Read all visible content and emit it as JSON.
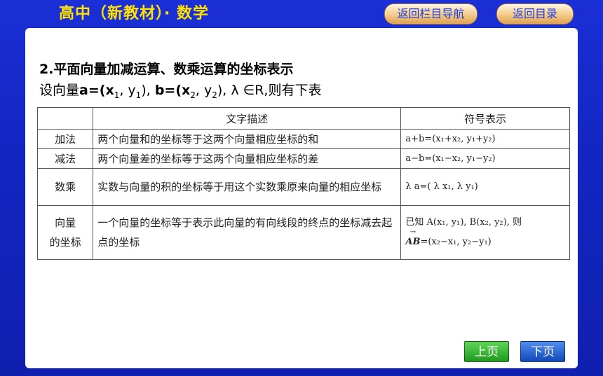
{
  "header": {
    "title": "高中（新教材）· 数学",
    "nav_back_section": "返回栏目导航",
    "nav_back_toc": "返回目录"
  },
  "content": {
    "heading": "2.平面向量加减运算、数乘运算的坐标表示",
    "intro_prefix": "设向量",
    "intro_a": "a=(x",
    "intro_a_sub1": "1",
    "intro_a_mid": ", y",
    "intro_a_sub2": "1",
    "intro_a_end": "), ",
    "intro_b": "b=(x",
    "intro_b_sub1": "2",
    "intro_b_mid": ", y",
    "intro_b_sub2": "2",
    "intro_b_end": "), λ ∈R,则有下表"
  },
  "table": {
    "headers": [
      "",
      "文字描述",
      "符号表示"
    ],
    "rows": [
      {
        "name": "加法",
        "desc": "两个向量和的坐标等于这两个向量相应坐标的和",
        "formula": "a+b=(x₁+x₂, y₁+y₂)"
      },
      {
        "name": "减法",
        "desc": "两个向量差的坐标等于这两个向量相应坐标的差",
        "formula": "a−b=(x₁−x₂, y₁−y₂)"
      },
      {
        "name": "数乘",
        "desc": "实数与向量的积的坐标等于用这个实数乘原来向量的相应坐标",
        "formula": "λ a=( λ x₁, λ y₁)"
      },
      {
        "name_line1": "向量",
        "name_line2": "的坐标",
        "desc": "一个向量的坐标等于表示此向量的有向线段的终点的坐标减去起点的坐标",
        "formula_line1": "已知 A(x₁, y₁), B(x₂, y₂), 则",
        "formula_vec": "AB",
        "formula_line2": "=(x₂−x₁, y₂−y₁)"
      }
    ]
  },
  "footer": {
    "prev_label": "上页",
    "next_label": "下页"
  }
}
